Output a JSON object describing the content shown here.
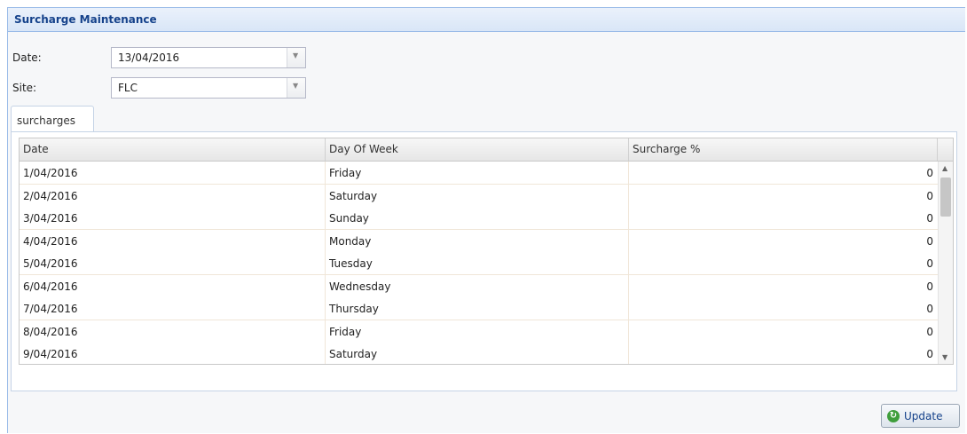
{
  "panel": {
    "title": "Surcharge Maintenance"
  },
  "form": {
    "date_label": "Date:",
    "date_value": "13/04/2016",
    "site_label": "Site:",
    "site_value": "FLC"
  },
  "tabs": [
    {
      "label": "surcharges"
    }
  ],
  "grid": {
    "columns": [
      "Date",
      "Day Of Week",
      "Surcharge %"
    ],
    "rows": [
      {
        "date": "1/04/2016",
        "day": "Friday",
        "surcharge": "0"
      },
      {
        "date": "2/04/2016",
        "day": "Saturday",
        "surcharge": "0"
      },
      {
        "date": "3/04/2016",
        "day": "Sunday",
        "surcharge": "0"
      },
      {
        "date": "4/04/2016",
        "day": "Monday",
        "surcharge": "0"
      },
      {
        "date": "5/04/2016",
        "day": "Tuesday",
        "surcharge": "0"
      },
      {
        "date": "6/04/2016",
        "day": "Wednesday",
        "surcharge": "0"
      },
      {
        "date": "7/04/2016",
        "day": "Thursday",
        "surcharge": "0"
      },
      {
        "date": "8/04/2016",
        "day": "Friday",
        "surcharge": "0"
      },
      {
        "date": "9/04/2016",
        "day": "Saturday",
        "surcharge": "0"
      }
    ]
  },
  "buttons": {
    "update_label": "Update",
    "update_icon": "refresh-icon"
  },
  "colors": {
    "header_text": "#15428b",
    "border": "#99bbe8",
    "icon_green": "#3f9e3c"
  }
}
